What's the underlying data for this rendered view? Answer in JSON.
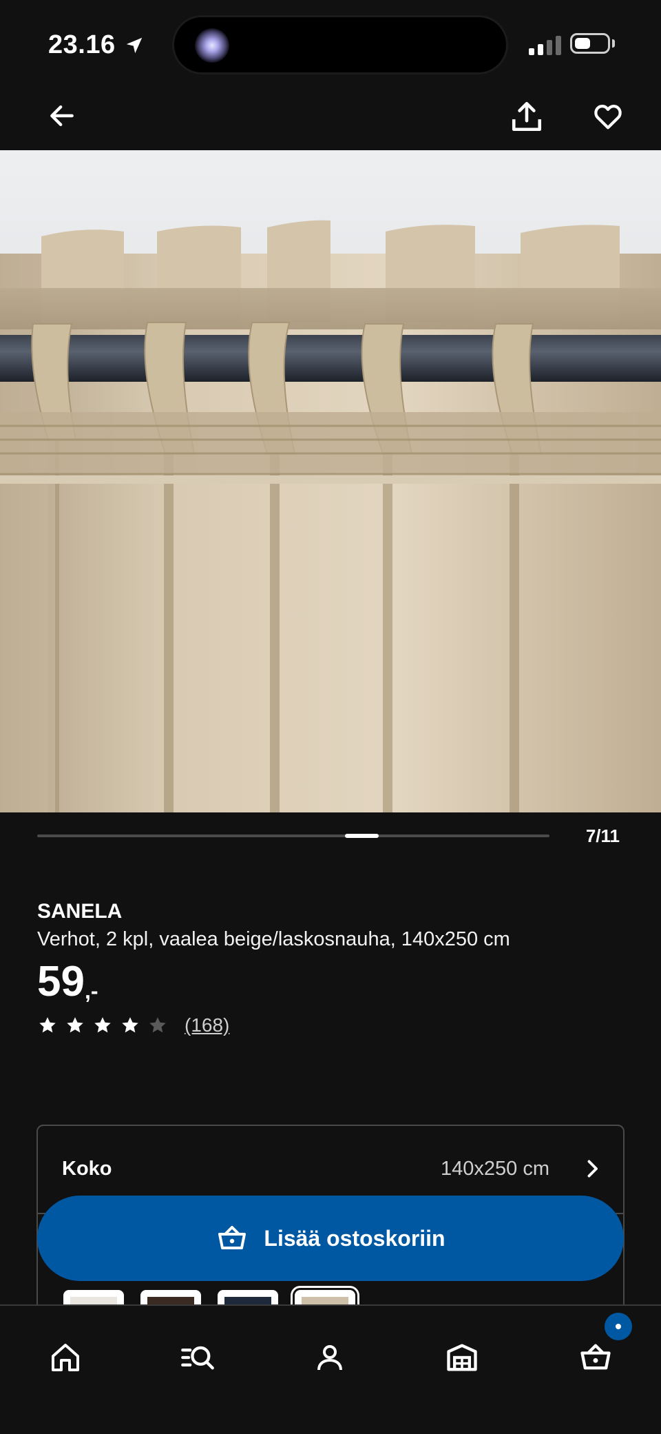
{
  "status_bar": {
    "time": "23.16",
    "location_icon": "location-arrow-icon",
    "signal_icon": "cellular-signal-icon",
    "battery_icon": "battery-icon"
  },
  "header": {
    "back_icon": "arrow-left-icon",
    "share_icon": "share-icon",
    "favorite_icon": "heart-icon"
  },
  "gallery": {
    "image_description": "product-photo",
    "current": 7,
    "total": 11,
    "counter": "7/11"
  },
  "product": {
    "name": "SANELA",
    "description": "Verhot, 2 kpl, vaalea beige/laskosnauha, 140x250 cm",
    "price_main": "59",
    "price_suffix": ",-",
    "rating": 4,
    "rating_max": 5,
    "review_count": "(168)"
  },
  "options": {
    "size_label": "Koko",
    "size_value": "140x250 cm",
    "swatches": [
      {
        "color": "#e9e6df"
      },
      {
        "color": "#3a2a22"
      },
      {
        "color": "#1e2a3c"
      },
      {
        "color": "#cdbfa8",
        "selected": true
      }
    ]
  },
  "cart_button": {
    "label": "Lisää ostoskoriin",
    "icon": "basket-icon"
  },
  "bottom_nav": {
    "items": [
      {
        "icon": "home-icon"
      },
      {
        "icon": "search-list-icon"
      },
      {
        "icon": "profile-icon"
      },
      {
        "icon": "store-icon"
      },
      {
        "icon": "cart-icon"
      }
    ]
  },
  "colors": {
    "background": "#111111",
    "accent": "#0058a3",
    "text": "#ffffff",
    "muted": "#cfcfcf"
  }
}
